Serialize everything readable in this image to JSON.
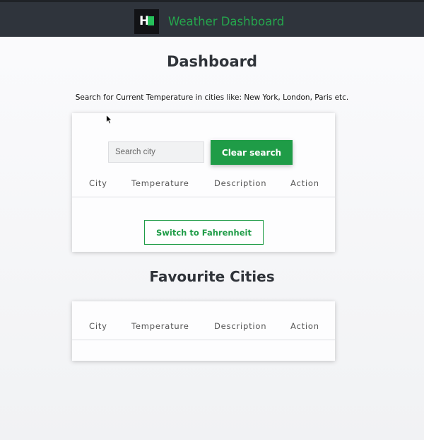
{
  "header": {
    "logo_letter": "H",
    "app_title": "Weather Dashboard"
  },
  "main": {
    "page_title": "Dashboard",
    "search_hint": "Search for Current Temperature in cities like: New York, London, Paris etc."
  },
  "search_card": {
    "search_placeholder": "Search city",
    "search_value": "",
    "clear_label": "Clear search",
    "columns": [
      "City",
      "Temperature",
      "Description",
      "Action"
    ],
    "rows": [],
    "switch_label": "Switch to Fahrenheit"
  },
  "favourites": {
    "title": "Favourite Cities",
    "columns": [
      "City",
      "Temperature",
      "Description",
      "Action"
    ],
    "rows": []
  },
  "colors": {
    "accent_green": "#1f9c47",
    "header_bg": "#2f343c",
    "logo_green": "#25c05a"
  }
}
